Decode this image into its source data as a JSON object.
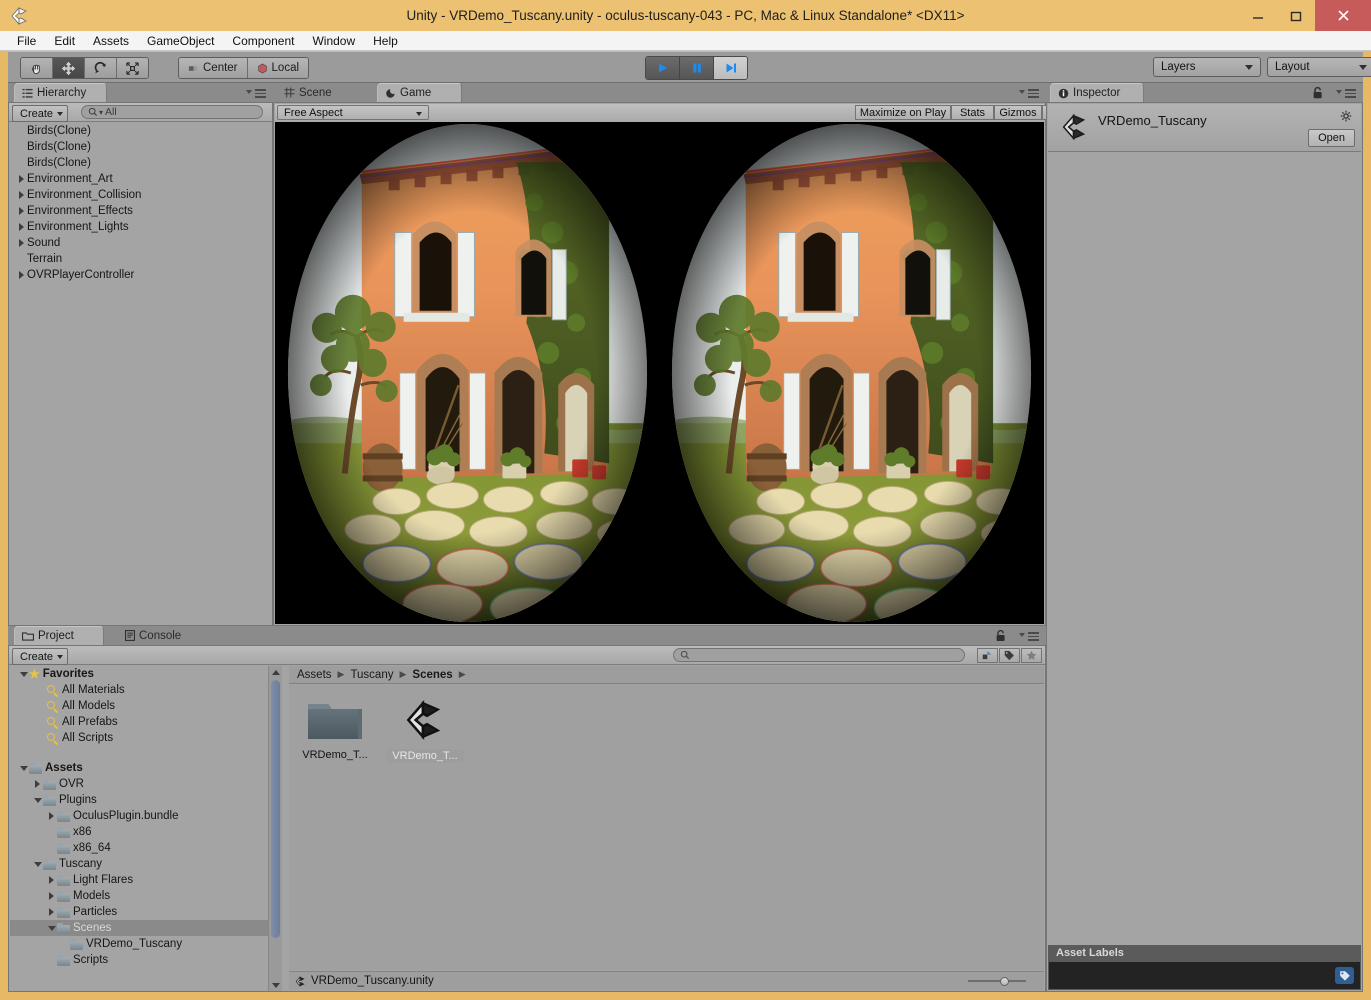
{
  "window": {
    "title": "Unity - VRDemo_Tuscany.unity - oculus-tuscany-043 - PC, Mac & Linux Standalone* <DX11>",
    "app_icon": "unity-logo-icon",
    "minimize": "–",
    "maximize": "☐",
    "close": "✕"
  },
  "menubar": {
    "items": [
      "File",
      "Edit",
      "Assets",
      "GameObject",
      "Component",
      "Window",
      "Help"
    ]
  },
  "toolbar": {
    "tools": [
      {
        "name": "hand-tool",
        "active": false
      },
      {
        "name": "move-tool",
        "active": true
      },
      {
        "name": "rotate-tool",
        "active": false
      },
      {
        "name": "scale-tool",
        "active": false
      }
    ],
    "pivot_mode": "Center",
    "handle_space": "Local",
    "play_controls": [
      {
        "name": "play-button",
        "active": true
      },
      {
        "name": "pause-button",
        "active": false
      },
      {
        "name": "step-button",
        "active": false
      }
    ],
    "layers_label": "Layers",
    "layout_label": "Layout"
  },
  "hierarchy": {
    "tab_label": "Hierarchy",
    "create_label": "Create",
    "search_placeholder": "All",
    "search_value": "All",
    "items": [
      {
        "label": "Birds(Clone)",
        "expandable": false,
        "indent": 0
      },
      {
        "label": "Birds(Clone)",
        "expandable": false,
        "indent": 0
      },
      {
        "label": "Birds(Clone)",
        "expandable": false,
        "indent": 0
      },
      {
        "label": "Environment_Art",
        "expandable": true,
        "indent": 0
      },
      {
        "label": "Environment_Collision",
        "expandable": true,
        "indent": 0
      },
      {
        "label": "Environment_Effects",
        "expandable": true,
        "indent": 0
      },
      {
        "label": "Environment_Lights",
        "expandable": true,
        "indent": 0
      },
      {
        "label": "Sound",
        "expandable": true,
        "indent": 0
      },
      {
        "label": "Terrain",
        "expandable": false,
        "indent": 0
      },
      {
        "label": "OVRPlayerController",
        "expandable": true,
        "indent": 0
      }
    ]
  },
  "center": {
    "tabs": [
      {
        "label": "Scene",
        "icon": "grid-icon",
        "active": false
      },
      {
        "label": "Game",
        "icon": "gamepad-icon",
        "active": true
      }
    ],
    "aspect_label": "Free Aspect",
    "maximize_on_play": "Maximize on Play",
    "stats": "Stats",
    "gizmos": "Gizmos",
    "render_description": "Stereo VR barrel-distorted render of the Tuscany villa demo scene"
  },
  "inspector": {
    "tab_label": "Inspector",
    "asset_name": "VRDemo_Tuscany",
    "asset_icon": "unity-scene-icon",
    "open_label": "Open",
    "lock_icon": "lock-icon",
    "gear_icon": "gear-icon"
  },
  "project": {
    "tabs": [
      {
        "label": "Project",
        "icon": "folder-icon",
        "active": true
      },
      {
        "label": "Console",
        "icon": "console-icon",
        "active": false
      }
    ],
    "create_label": "Create",
    "search_placeholder": "",
    "filters": [
      "type-filter-icon",
      "label-filter-icon",
      "favorite-filter-icon"
    ],
    "tree": [
      {
        "label": "Favorites",
        "icon": "star-icon",
        "indent": 0,
        "expanded": true,
        "bold": true,
        "selected": false
      },
      {
        "label": "All Materials",
        "icon": "search-icon",
        "indent": 1,
        "selected": false
      },
      {
        "label": "All Models",
        "icon": "search-icon",
        "indent": 1,
        "selected": false
      },
      {
        "label": "All Prefabs",
        "icon": "search-icon",
        "indent": 1,
        "selected": false
      },
      {
        "label": "All Scripts",
        "icon": "search-icon",
        "indent": 1,
        "selected": false
      },
      {
        "label": "",
        "icon": "",
        "indent": 0,
        "spacer": true
      },
      {
        "label": "Assets",
        "icon": "folder-icon",
        "indent": 0,
        "expanded": true,
        "bold": true,
        "selected": false
      },
      {
        "label": "OVR",
        "icon": "folder-icon",
        "indent": 1,
        "expandable": true,
        "selected": false
      },
      {
        "label": "Plugins",
        "icon": "folder-icon",
        "indent": 1,
        "expanded": true,
        "selected": false
      },
      {
        "label": "OculusPlugin.bundle",
        "icon": "folder-icon",
        "indent": 2,
        "expandable": true,
        "selected": false
      },
      {
        "label": "x86",
        "icon": "folder-icon",
        "indent": 2,
        "selected": false
      },
      {
        "label": "x86_64",
        "icon": "folder-icon",
        "indent": 2,
        "selected": false
      },
      {
        "label": "Tuscany",
        "icon": "folder-icon",
        "indent": 1,
        "expanded": true,
        "selected": false
      },
      {
        "label": "Light Flares",
        "icon": "folder-icon",
        "indent": 2,
        "expandable": true,
        "selected": false
      },
      {
        "label": "Models",
        "icon": "folder-icon",
        "indent": 2,
        "expandable": true,
        "selected": false
      },
      {
        "label": "Particles",
        "icon": "folder-icon",
        "indent": 2,
        "expandable": true,
        "selected": false
      },
      {
        "label": "Scenes",
        "icon": "folder-icon",
        "indent": 2,
        "expanded": true,
        "selected": true
      },
      {
        "label": "VRDemo_Tuscany",
        "icon": "folder-icon",
        "indent": 3,
        "selected": false
      },
      {
        "label": "Scripts",
        "icon": "folder-icon",
        "indent": 2,
        "selected": false
      }
    ],
    "breadcrumb": [
      "Assets",
      "Tuscany",
      "Scenes"
    ],
    "grid_items": [
      {
        "label": "VRDemo_T...",
        "icon": "folder-icon",
        "selected": false
      },
      {
        "label": "VRDemo_T...",
        "icon": "unity-scene-icon",
        "selected": true
      }
    ],
    "status_text": "VRDemo_Tuscany.unity",
    "status_icon": "unity-scene-icon",
    "zoom_value": 58
  },
  "asset_labels": {
    "title": "Asset Labels",
    "value": "",
    "tag_icon": "tag-icon"
  },
  "colors": {
    "titlebar": "#edc172",
    "close_button": "#c75b5b",
    "panel_bg": "#a4a4a4",
    "tab_active": "#b0b0b0",
    "selection": "#8a8a8a",
    "scrollbar": "#6c7d9a",
    "accent_blue": "#2f5e92",
    "play_blue": "#1a8bf0",
    "favorite_gold": "#e8c444"
  }
}
